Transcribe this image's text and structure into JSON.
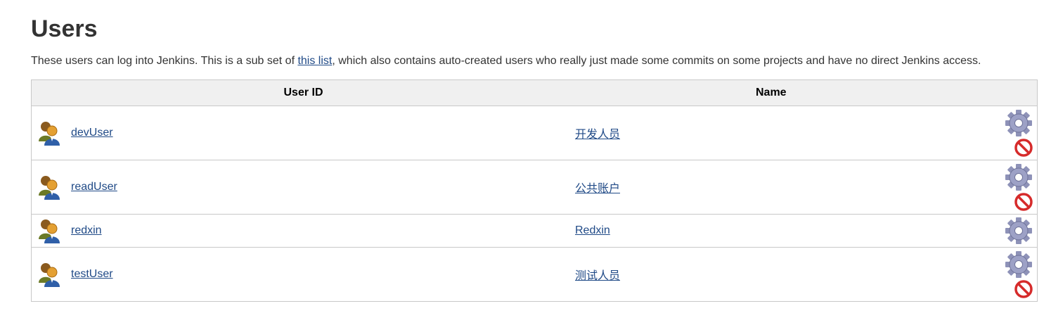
{
  "page": {
    "title": "Users",
    "description_before": "These users can log into Jenkins. This is a sub set of ",
    "description_link": "this list",
    "description_after": ", which also contains auto-created users who really just made some commits on some projects and have no direct Jenkins access."
  },
  "table": {
    "columns": [
      "User ID",
      "Name"
    ],
    "rows": [
      {
        "user_id": "devUser",
        "name": "开发人员",
        "actions": [
          "gear-icon",
          "delete-icon"
        ]
      },
      {
        "user_id": "readUser",
        "name": "公共账户",
        "actions": [
          "gear-icon",
          "delete-icon"
        ]
      },
      {
        "user_id": "redxin",
        "name": "Redxin",
        "actions": [
          "gear-icon"
        ]
      },
      {
        "user_id": "testUser",
        "name": "测试人员",
        "actions": [
          "gear-icon",
          "delete-icon"
        ]
      }
    ]
  },
  "colors": {
    "link": "#204a87",
    "header_bg": "#f0f0f0",
    "border": "#c8c8c8",
    "delete_red": "#d62b2b"
  }
}
